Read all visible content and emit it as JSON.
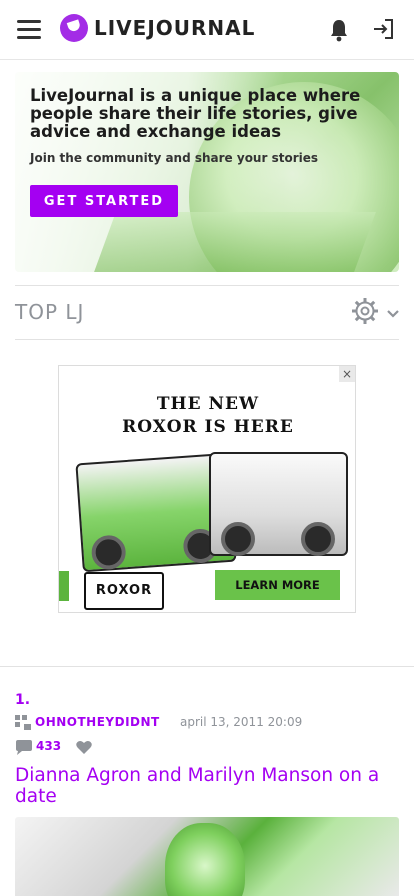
{
  "header": {
    "logo_text": "LIVEJOURNAL",
    "icons": [
      "menu-icon",
      "livejournal-logo-icon",
      "bell-icon",
      "login-icon"
    ]
  },
  "hero": {
    "title": "LiveJournal is a unique place where people share their life stories, give advice and exchange ideas",
    "subtitle": "Join the community and share your stories",
    "button": "GET STARTED"
  },
  "section": {
    "title": "TOP LJ",
    "icons": [
      "gear-icon",
      "chevron-down-icon"
    ]
  },
  "ad": {
    "close": "×",
    "headline_line1": "THE NEW",
    "headline_line2": "ROXOR IS HERE",
    "brand": "ROXOR",
    "cta": "LEARN MORE"
  },
  "post": {
    "number": "1.",
    "username": "OHNOTHEYDIDNT",
    "date": "april 13, 2011 20:09",
    "comments": "433",
    "title": "Dianna Agron and Marilyn Manson on a date"
  },
  "colors": {
    "accent": "#a400f2",
    "muted": "#8f9399",
    "ad_green": "#6ac24a"
  }
}
